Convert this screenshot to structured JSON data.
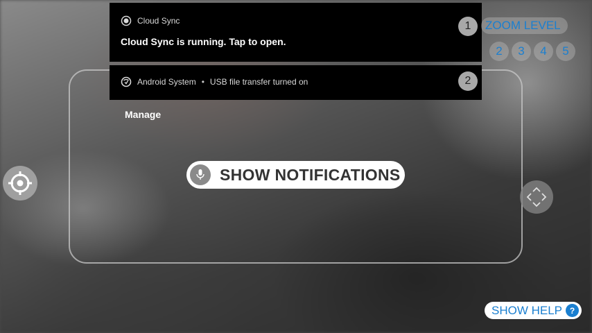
{
  "notifications": [
    {
      "app": "Cloud Sync",
      "icon": "cloud-sync-icon",
      "message": "Cloud Sync is running. Tap to open.",
      "badge": "1"
    },
    {
      "app": "Android System",
      "separator": "•",
      "summary": "USB file transfer turned on",
      "icon": "android-system-icon",
      "badge": "2"
    }
  ],
  "manage_label": "Manage",
  "zoom": {
    "label": "ZOOM LEVEL",
    "levels": [
      "2",
      "3",
      "4",
      "5"
    ]
  },
  "voice_command": {
    "label": "SHOW NOTIFICATIONS",
    "icon": "microphone-icon"
  },
  "help": {
    "label": "SHOW HELP",
    "icon_glyph": "?"
  },
  "colors": {
    "accent": "#1a7fd0",
    "notification_bg": "#000000",
    "badge_bg": "#a8a8a8"
  }
}
